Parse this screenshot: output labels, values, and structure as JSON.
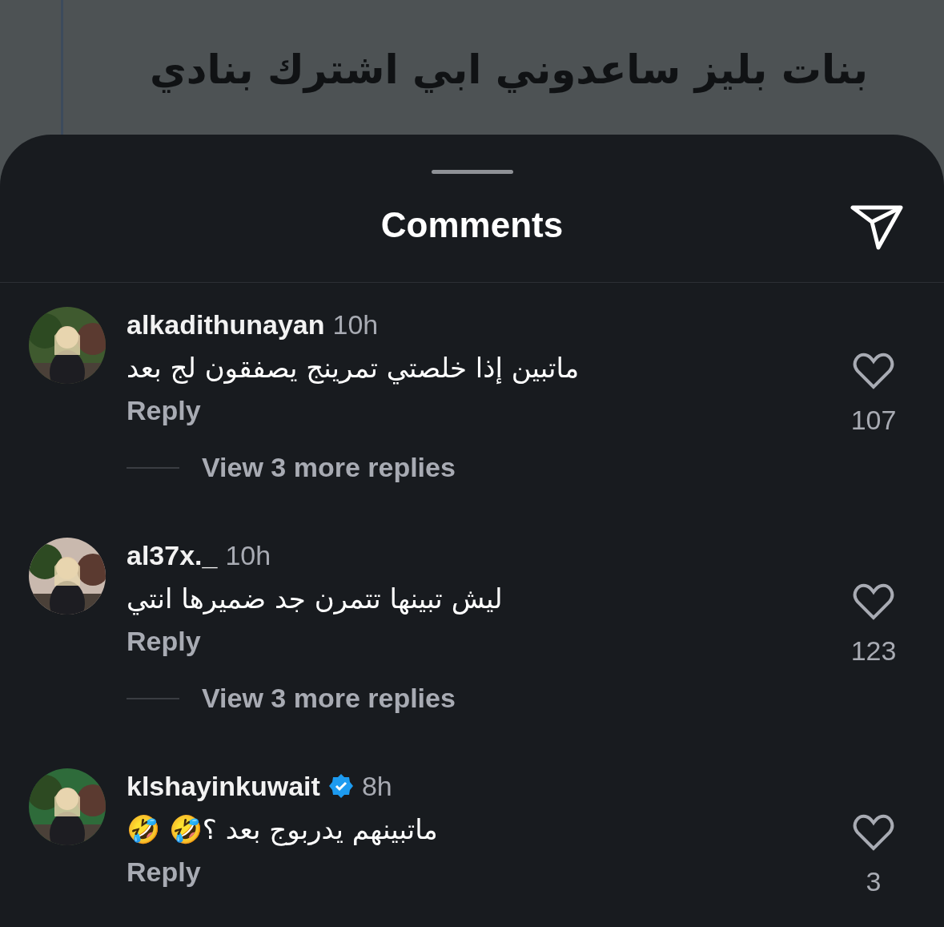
{
  "background_post": {
    "title": "بنات بليز ساعدوني ابي اشترك بنادي"
  },
  "sheet": {
    "title": "Comments"
  },
  "comments": [
    {
      "username": "alkadithunayan",
      "verified": false,
      "time": "10h",
      "text": "ماتبين إذا خلصتي تمرينج يصفقون لج بعد",
      "reply": "Reply",
      "likes": "107",
      "more_replies": "View 3 more replies"
    },
    {
      "username": "al37x._",
      "verified": false,
      "time": "10h",
      "text": "ليش تبينها تتمرن جد ضميرها انتي",
      "reply": "Reply",
      "likes": "123",
      "more_replies": "View 3 more replies"
    },
    {
      "username": "klshayinkuwait",
      "verified": true,
      "time": "8h",
      "text": "ماتبينهم يدربوج بعد ؟🤣 🤣",
      "reply": "Reply",
      "likes": "3"
    }
  ]
}
